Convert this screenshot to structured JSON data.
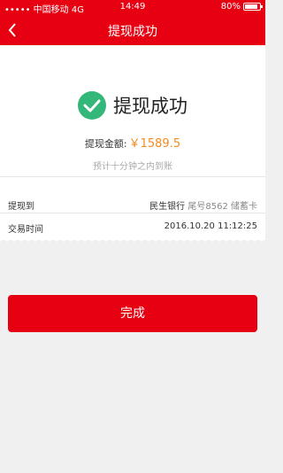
{
  "status_bar": {
    "carrier": "••••• 中国移动  4G",
    "time": "14:49",
    "battery": "80%"
  },
  "nav": {
    "title": "提现成功"
  },
  "result": {
    "title": "提现成功",
    "amount_label": "提现金额:",
    "amount": "￥1589.5",
    "hint": "预计十分钟之内到账"
  },
  "details": {
    "bank_label": "提现到",
    "bank_name": "民生银行",
    "bank_account": "尾号8562 储蓄卡",
    "time_label": "交易时间",
    "time_value": "2016.10.20 11:12:25"
  },
  "actions": {
    "done": "完成"
  },
  "colors": {
    "brand": "#e60012",
    "amount": "#f08c1e",
    "success": "#33b87a"
  }
}
